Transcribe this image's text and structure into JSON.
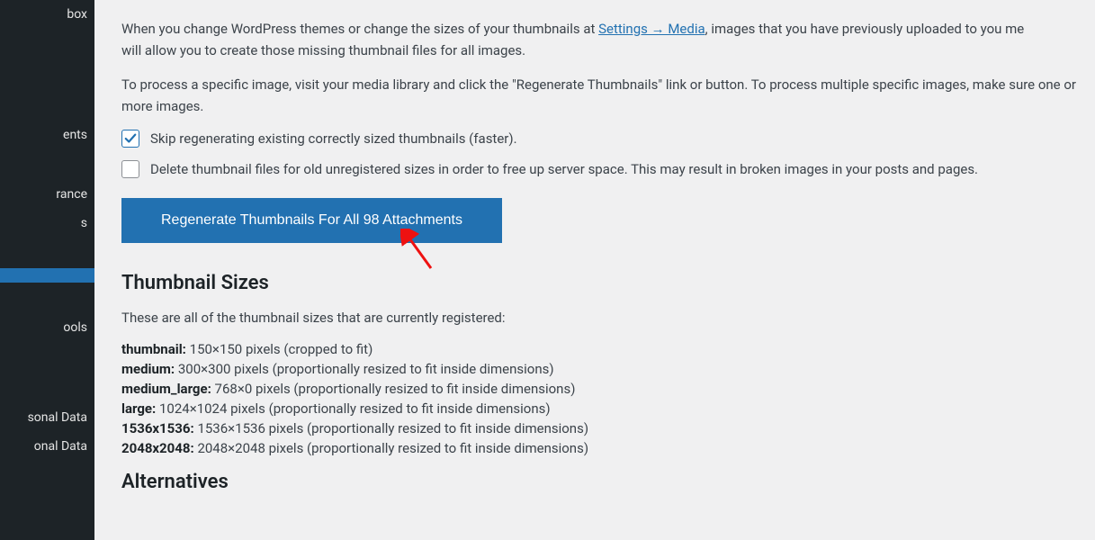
{
  "sidebar": {
    "items": [
      {
        "label": "box",
        "active": false
      },
      {
        "label": "",
        "active": false,
        "gap": true
      },
      {
        "label": "",
        "active": false,
        "gap": true
      },
      {
        "label": "",
        "active": false,
        "gap": true
      },
      {
        "label": "ents",
        "active": false
      },
      {
        "label": "",
        "active": false,
        "gap": true
      },
      {
        "label": "rance",
        "active": false
      },
      {
        "label": "s",
        "active": false
      },
      {
        "label": "",
        "active": false,
        "gap": true
      },
      {
        "label": "",
        "active": true
      },
      {
        "label": "",
        "active": false,
        "gap": true
      },
      {
        "label": "ools",
        "active": false
      },
      {
        "label": "",
        "active": false,
        "gap": true
      },
      {
        "label": "",
        "active": false,
        "gap": true
      },
      {
        "label": "sonal Data",
        "active": false
      },
      {
        "label": "onal Data",
        "active": false
      }
    ]
  },
  "intro": {
    "p1a": "When you change WordPress themes or change the sizes of your thumbnails at ",
    "link": "Settings → Media",
    "p1b": ", images that you have previously uploaded to you me",
    "p1c": "will allow you to create those missing thumbnail files for all images.",
    "p2": "To process a specific image, visit your media library and click the \"Regenerate Thumbnails\" link or button. To process multiple specific images, make sure one or more images."
  },
  "checks": {
    "skip": {
      "checked": true,
      "label": "Skip regenerating existing correctly sized thumbnails (faster)."
    },
    "delete": {
      "checked": false,
      "label": "Delete thumbnail files for old unregistered sizes in order to free up server space. This may result in broken images in your posts and pages."
    }
  },
  "button": {
    "label": "Regenerate Thumbnails For All 98 Attachments"
  },
  "sizes": {
    "heading": "Thumbnail Sizes",
    "intro": "These are all of the thumbnail sizes that are currently registered:",
    "list": [
      {
        "name": "thumbnail:",
        "desc": " 150×150 pixels (cropped to fit)"
      },
      {
        "name": "medium:",
        "desc": " 300×300 pixels (proportionally resized to fit inside dimensions)"
      },
      {
        "name": "medium_large:",
        "desc": " 768×0 pixels (proportionally resized to fit inside dimensions)"
      },
      {
        "name": "large:",
        "desc": " 1024×1024 pixels (proportionally resized to fit inside dimensions)"
      },
      {
        "name": "1536x1536:",
        "desc": " 1536×1536 pixels (proportionally resized to fit inside dimensions)"
      },
      {
        "name": "2048x2048:",
        "desc": " 2048×2048 pixels (proportionally resized to fit inside dimensions)"
      }
    ]
  },
  "alt_heading": "Alternatives"
}
